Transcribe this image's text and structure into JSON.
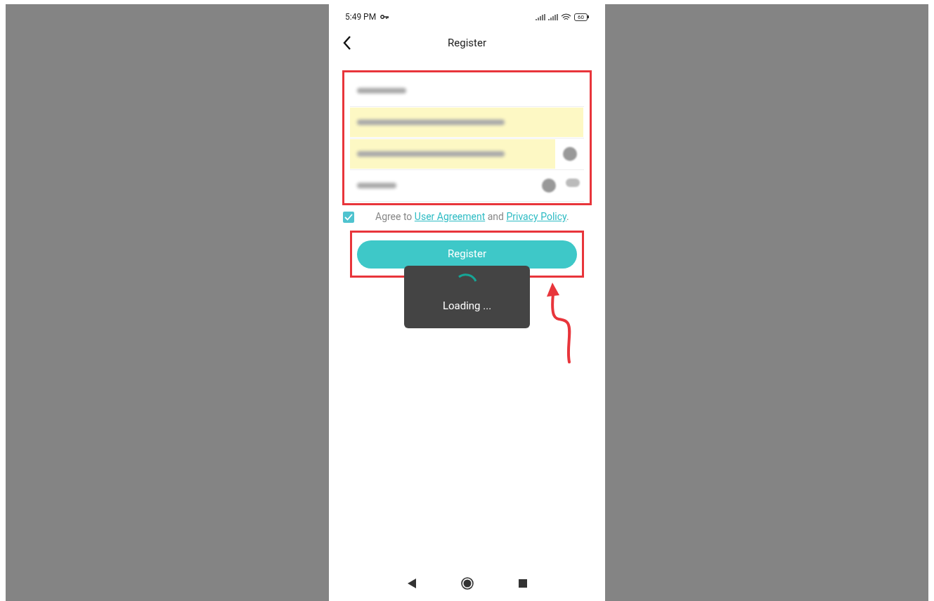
{
  "status_bar": {
    "time": "5:49 PM",
    "battery": "60"
  },
  "header": {
    "title": "Register"
  },
  "fields": [
    {
      "kind": "plain",
      "autofilled": false
    },
    {
      "kind": "plain",
      "autofilled": true
    },
    {
      "kind": "clearable",
      "autofilled": true
    },
    {
      "kind": "password",
      "autofilled": false
    }
  ],
  "agreement": {
    "checked": true,
    "prefix": "Agree to ",
    "link_1": "User Agreement",
    "middle": " and ",
    "link_2": "Privacy Policy",
    "suffix": "."
  },
  "register_button": {
    "label": "Register"
  },
  "toast": {
    "text": "Loading ..."
  }
}
